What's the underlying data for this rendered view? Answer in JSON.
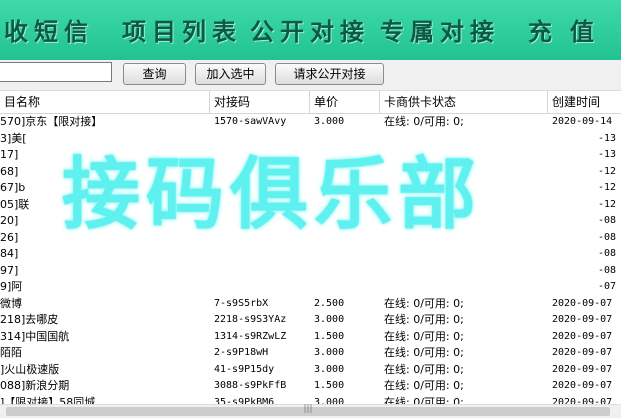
{
  "nav": {
    "items": [
      {
        "label": "收短信"
      },
      {
        "label": "项目列表"
      },
      {
        "label": "公开对接"
      },
      {
        "label": "专属对接"
      },
      {
        "label": "充值"
      }
    ]
  },
  "toolbar": {
    "search_value": "",
    "query_label": "查询",
    "add_selected_label": "加入选中",
    "request_public_label": "请求公开对接"
  },
  "table": {
    "headers": [
      "目名称",
      "对接码",
      "单价",
      "卡商供卡状态",
      "创建时间"
    ],
    "rows": [
      {
        "name": "570]京东【限对接】",
        "code": "1570-sawVAvy",
        "price": "3.000",
        "status": "在线: 0/可用: 0;",
        "date": "2020-09-14"
      },
      {
        "name": "3]美[",
        "code": "",
        "price": "",
        "status": "",
        "date": "-13"
      },
      {
        "name": "17]",
        "code": "",
        "price": "",
        "status": "",
        "date": "-13"
      },
      {
        "name": "68]",
        "code": "",
        "price": "",
        "status": "",
        "date": "-12"
      },
      {
        "name": "67]b",
        "code": "",
        "price": "",
        "status": "",
        "date": "-12"
      },
      {
        "name": "05]联",
        "code": "",
        "price": "",
        "status": "",
        "date": "-12"
      },
      {
        "name": "20]",
        "code": "",
        "price": "",
        "status": "",
        "date": "-08"
      },
      {
        "name": "26]",
        "code": "",
        "price": "",
        "status": "",
        "date": "-08"
      },
      {
        "name": "84]",
        "code": "",
        "price": "",
        "status": "",
        "date": "-08"
      },
      {
        "name": "97]",
        "code": "",
        "price": "",
        "status": "",
        "date": "-08"
      },
      {
        "name": "9]阿",
        "code": "",
        "price": "",
        "status": "",
        "date": "-07"
      },
      {
        "name": "微博",
        "code": "7-s9S5rbX",
        "price": "2.500",
        "status": "在线: 0/可用: 0;",
        "date": "2020-09-07"
      },
      {
        "name": "218]去哪皮",
        "code": "2218-s9S3YAz",
        "price": "3.000",
        "status": "在线: 0/可用: 0;",
        "date": "2020-09-07"
      },
      {
        "name": "314]中国国航",
        "code": "1314-s9RZwLZ",
        "price": "1.500",
        "status": "在线: 0/可用: 0;",
        "date": "2020-09-07"
      },
      {
        "name": "陌陌",
        "code": "2-s9P18wH",
        "price": "3.000",
        "status": "在线: 0/可用: 0;",
        "date": "2020-09-07"
      },
      {
        "name": "]火山极速版",
        "code": "41-s9P15dy",
        "price": "3.000",
        "status": "在线: 0/可用: 0;",
        "date": "2020-09-07"
      },
      {
        "name": "088]新浪分期",
        "code": "3088-s9PkFfB",
        "price": "1.500",
        "status": "在线: 0/可用: 0;",
        "date": "2020-09-07"
      },
      {
        "name": "]【限对接】58同城",
        "code": "35-s9PkBM6",
        "price": "3.000",
        "status": "在线: 0/可用: 0;",
        "date": "2020-09-07"
      }
    ]
  },
  "watermark": "接码俱乐部",
  "scroll_grip": "|||"
}
